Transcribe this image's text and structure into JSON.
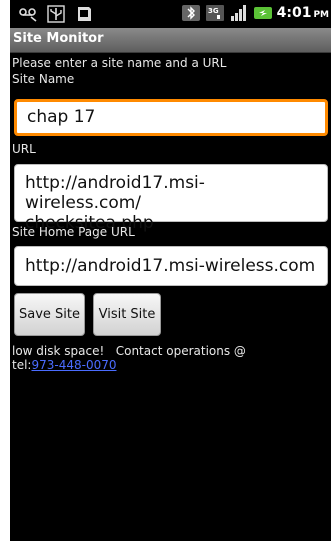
{
  "status": {
    "time": "4:01",
    "ampm": "PM"
  },
  "app": {
    "title": "Site Monitor"
  },
  "form": {
    "instruction": "Please enter a site name and a URL",
    "site_name_label": "Site Name",
    "site_name_value": "chap 17",
    "url_label": "URL",
    "url_value_line1": "http://android17.msi-wireless.com/",
    "url_value_line2": "checksitea.php",
    "home_label": "Site Home Page URL",
    "home_value": "http://android17.msi-wireless.com"
  },
  "buttons": {
    "save": "Save Site",
    "visit": "Visit Site"
  },
  "message": {
    "text": "low disk space!   Contact operations @",
    "prefix": "tel:",
    "phone": "973-448-0070"
  },
  "icons": [
    "voicemail-icon",
    "usb-icon",
    "sdcard-icon",
    "bluetooth-icon",
    "3g-icon",
    "signal-icon",
    "battery-icon"
  ],
  "colors": {
    "focus": "#ff8a00",
    "link": "#4a6cff",
    "battery": "#5bc236"
  }
}
